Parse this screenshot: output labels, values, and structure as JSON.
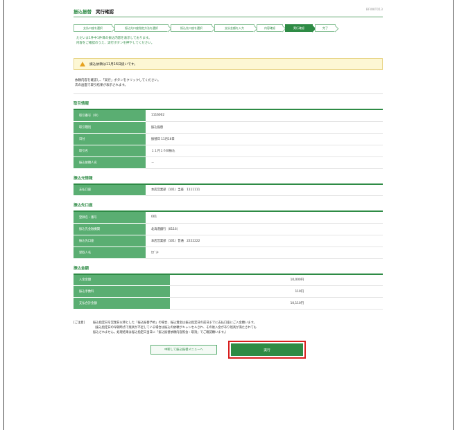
{
  "header": {
    "service": "振込振替",
    "screen_title": "実行確認",
    "screen_code": "BFWKT013"
  },
  "steps": [
    "支払口座を選択",
    "振込先口座指定方法を選択",
    "振込先口座を選択",
    "支払金額を入力",
    "内容確認",
    "実行確認",
    "完了"
  ],
  "lead_text": [
    "ただいま1件中1件目の振込内容を表示しております。",
    "内容をご確認のうえ、実行ボタンを押下してください。"
  ],
  "notice": "振込依頼は11月16日扱いです。",
  "instructions": [
    "依頼内容を確認し、「実行」ボタンをクリックしてください。",
    "次の画面で取引結果が表示されます。"
  ],
  "transaction": {
    "title": "取引情報",
    "rows": [
      {
        "label": "取引番号（ID）",
        "value": "1116002"
      },
      {
        "label": "取引種別",
        "value": "振込振替"
      },
      {
        "label": "日付",
        "value": "振替日 11月16日"
      },
      {
        "label": "取引名",
        "value": "１１月１６日振込"
      },
      {
        "label": "振込依頼人名",
        "value": "－"
      }
    ]
  },
  "source": {
    "title": "振込元情報",
    "rows": [
      {
        "label": "支払口座",
        "value": "本店営業部（101）当座　1111111"
      }
    ]
  },
  "destination": {
    "title": "振込先口座",
    "rows": [
      {
        "label": "登録名・番号",
        "value": "001"
      },
      {
        "label": "振込先金融機関",
        "value": "北海道銀行（0116）"
      },
      {
        "label": "振込先口座",
        "value": "本店営業部（101）普通　2222222"
      },
      {
        "label": "受取人名",
        "value": "ｶﾌﾞｼｷ"
      }
    ]
  },
  "amount": {
    "title": "振込金額",
    "rows": [
      {
        "label": "入金金額",
        "value": "10,000円"
      },
      {
        "label": "振込手数料",
        "value": "110円"
      },
      {
        "label": "支払合計金額",
        "value": "10,110円"
      }
    ]
  },
  "caution": {
    "label": "[ご注意]",
    "lines": [
      "振込指定日を営業日以降とした「振込振替予約」の場合、振込資金は振込指定日の前日までに支払口座にご入金願います。",
      "（振込指定日の早朝時点で残高が不足している場合は振込の依頼がキャンセルされ、その後入金があり残高が満たされても",
      "振込されません。処理結果は振込指定日当日に「振込振替依頼内容照会・取消」でご確認願います。）"
    ]
  },
  "buttons": {
    "back": "中断して振込振替メニューへ",
    "execute": "実行"
  },
  "colors": {
    "accent": "#2e8b45",
    "header_cell": "#5aae72",
    "highlight": "#d81e1e"
  }
}
